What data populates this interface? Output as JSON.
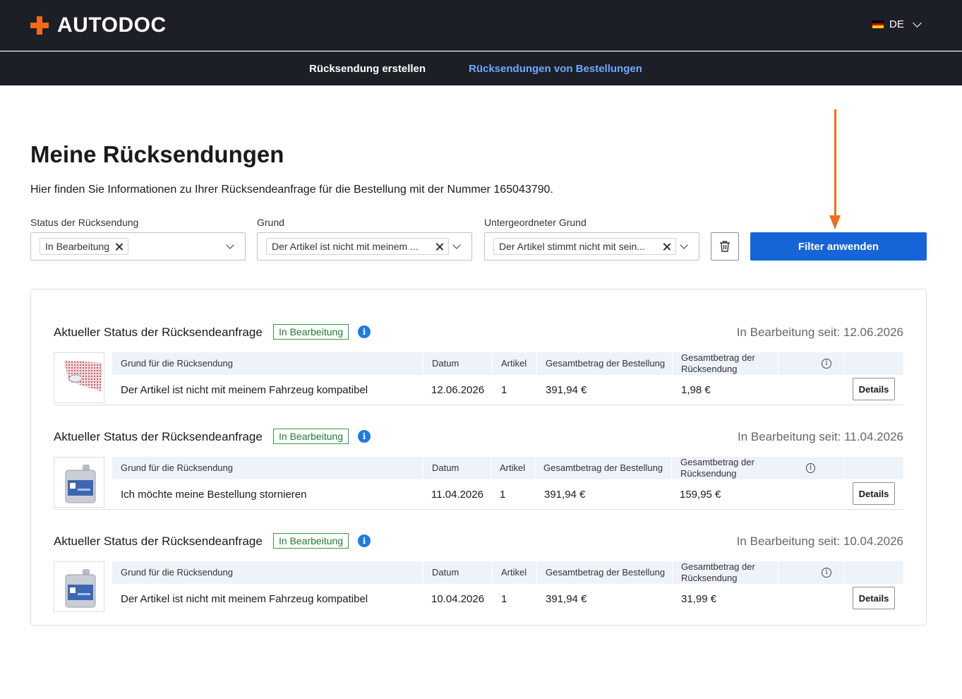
{
  "header": {
    "logo_text": "AUTODOC",
    "language": "DE",
    "colors": {
      "background": "#1c1f26",
      "accent": "#f26b1d"
    }
  },
  "nav": {
    "items": [
      {
        "label": "Rücksendung erstellen",
        "active": false
      },
      {
        "label": "Rücksendungen von Bestellungen",
        "active": true
      }
    ]
  },
  "page": {
    "title": "Meine Rücksendungen",
    "intro": "Hier finden Sie Informationen zu Ihrer Rücksendeanfrage für die Bestellung mit der Nummer 165043790."
  },
  "filters": {
    "status": {
      "label": "Status der Rücksendung",
      "chip": "In Bearbeitung"
    },
    "reason": {
      "label": "Grund",
      "chip": "Der Artikel ist nicht mit meinem ..."
    },
    "subreason": {
      "label": "Untergeordneter Grund",
      "chip": "Der Artikel stimmt nicht mit sein..."
    },
    "clear_icon": "trash-icon",
    "apply_label": "Filter anwenden",
    "apply_color": "#1565d8"
  },
  "returns": [
    {
      "status_title": "Aktueller Status der Rücksendeanfrage",
      "badge": "In Bearbeitung",
      "since": "In Bearbeitung seit: 12.06.2026",
      "thumb": "gasket-image",
      "headers": {
        "reason": "Grund für die Rücksendung",
        "date": "Datum",
        "items": "Artikel",
        "order_total": "Gesamtbetrag der Bestellung",
        "return_total": "Gesamtbetrag der Rücksendung"
      },
      "reason": "Der Artikel ist nicht mit meinem Fahrzeug kompatibel",
      "date": "12.06.2026",
      "items": "1",
      "order_total": "391,94 €",
      "return_total": "1,98 €",
      "details_label": "Details"
    },
    {
      "status_title": "Aktueller Status der Rücksendeanfrage",
      "badge": "In Bearbeitung",
      "since": "In Bearbeitung seit: 11.04.2026",
      "thumb": "oil-canister-image",
      "headers": {
        "reason": "Grund für die Rücksendung",
        "date": "Datum",
        "items": "Artikel",
        "order_total": "Gesamtbetrag der Bestellung",
        "return_total": "Gesamtbetrag der Rücksendung"
      },
      "reason": "Ich möchte meine Bestellung stornieren",
      "date": "11.04.2026",
      "items": "1",
      "order_total": "391,94 €",
      "return_total": "159,95 €",
      "details_label": "Details"
    },
    {
      "status_title": "Aktueller Status der Rücksendeanfrage",
      "badge": "In Bearbeitung",
      "since": "In Bearbeitung seit: 10.04.2026",
      "thumb": "oil-canister-image",
      "headers": {
        "reason": "Grund für die Rücksendung",
        "date": "Datum",
        "items": "Artikel",
        "order_total": "Gesamtbetrag der Bestellung",
        "return_total": "Gesamtbetrag der Rücksendung"
      },
      "reason": "Der Artikel ist nicht mit meinem Fahrzeug kompatibel",
      "date": "10.04.2026",
      "items": "1",
      "order_total": "391,94 €",
      "return_total": "31,99 €",
      "details_label": "Details"
    }
  ]
}
